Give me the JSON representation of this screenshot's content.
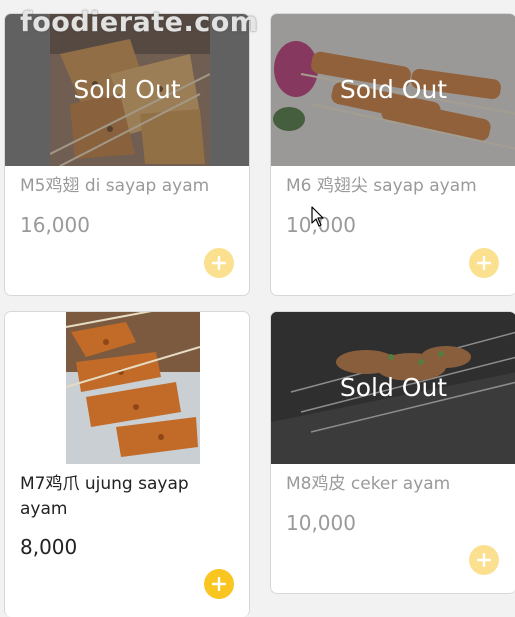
{
  "watermark": "foodierate.com",
  "items": [
    {
      "code_name": "M5鸡翅 di sayap ayam",
      "price": "16,000",
      "status": "Sold Out",
      "available": false,
      "icon": "plus-icon"
    },
    {
      "code_name": "M6 鸡翅尖 sayap ayam",
      "price": "10,000",
      "status": "Sold Out",
      "available": false,
      "icon": "plus-icon"
    },
    {
      "code_name": "M7鸡爪 ujung sayap ayam",
      "price": "8,000",
      "status": "",
      "available": true,
      "icon": "plus-icon"
    },
    {
      "code_name": "M8鸡皮 ceker ayam",
      "price": "10,000",
      "status": "Sold Out",
      "available": false,
      "icon": "plus-icon"
    }
  ],
  "colors": {
    "button_active": "#f9c521",
    "button_disabled": "#fbe18f",
    "text_dim": "#9a9a9a",
    "text_dark": "#222222"
  }
}
